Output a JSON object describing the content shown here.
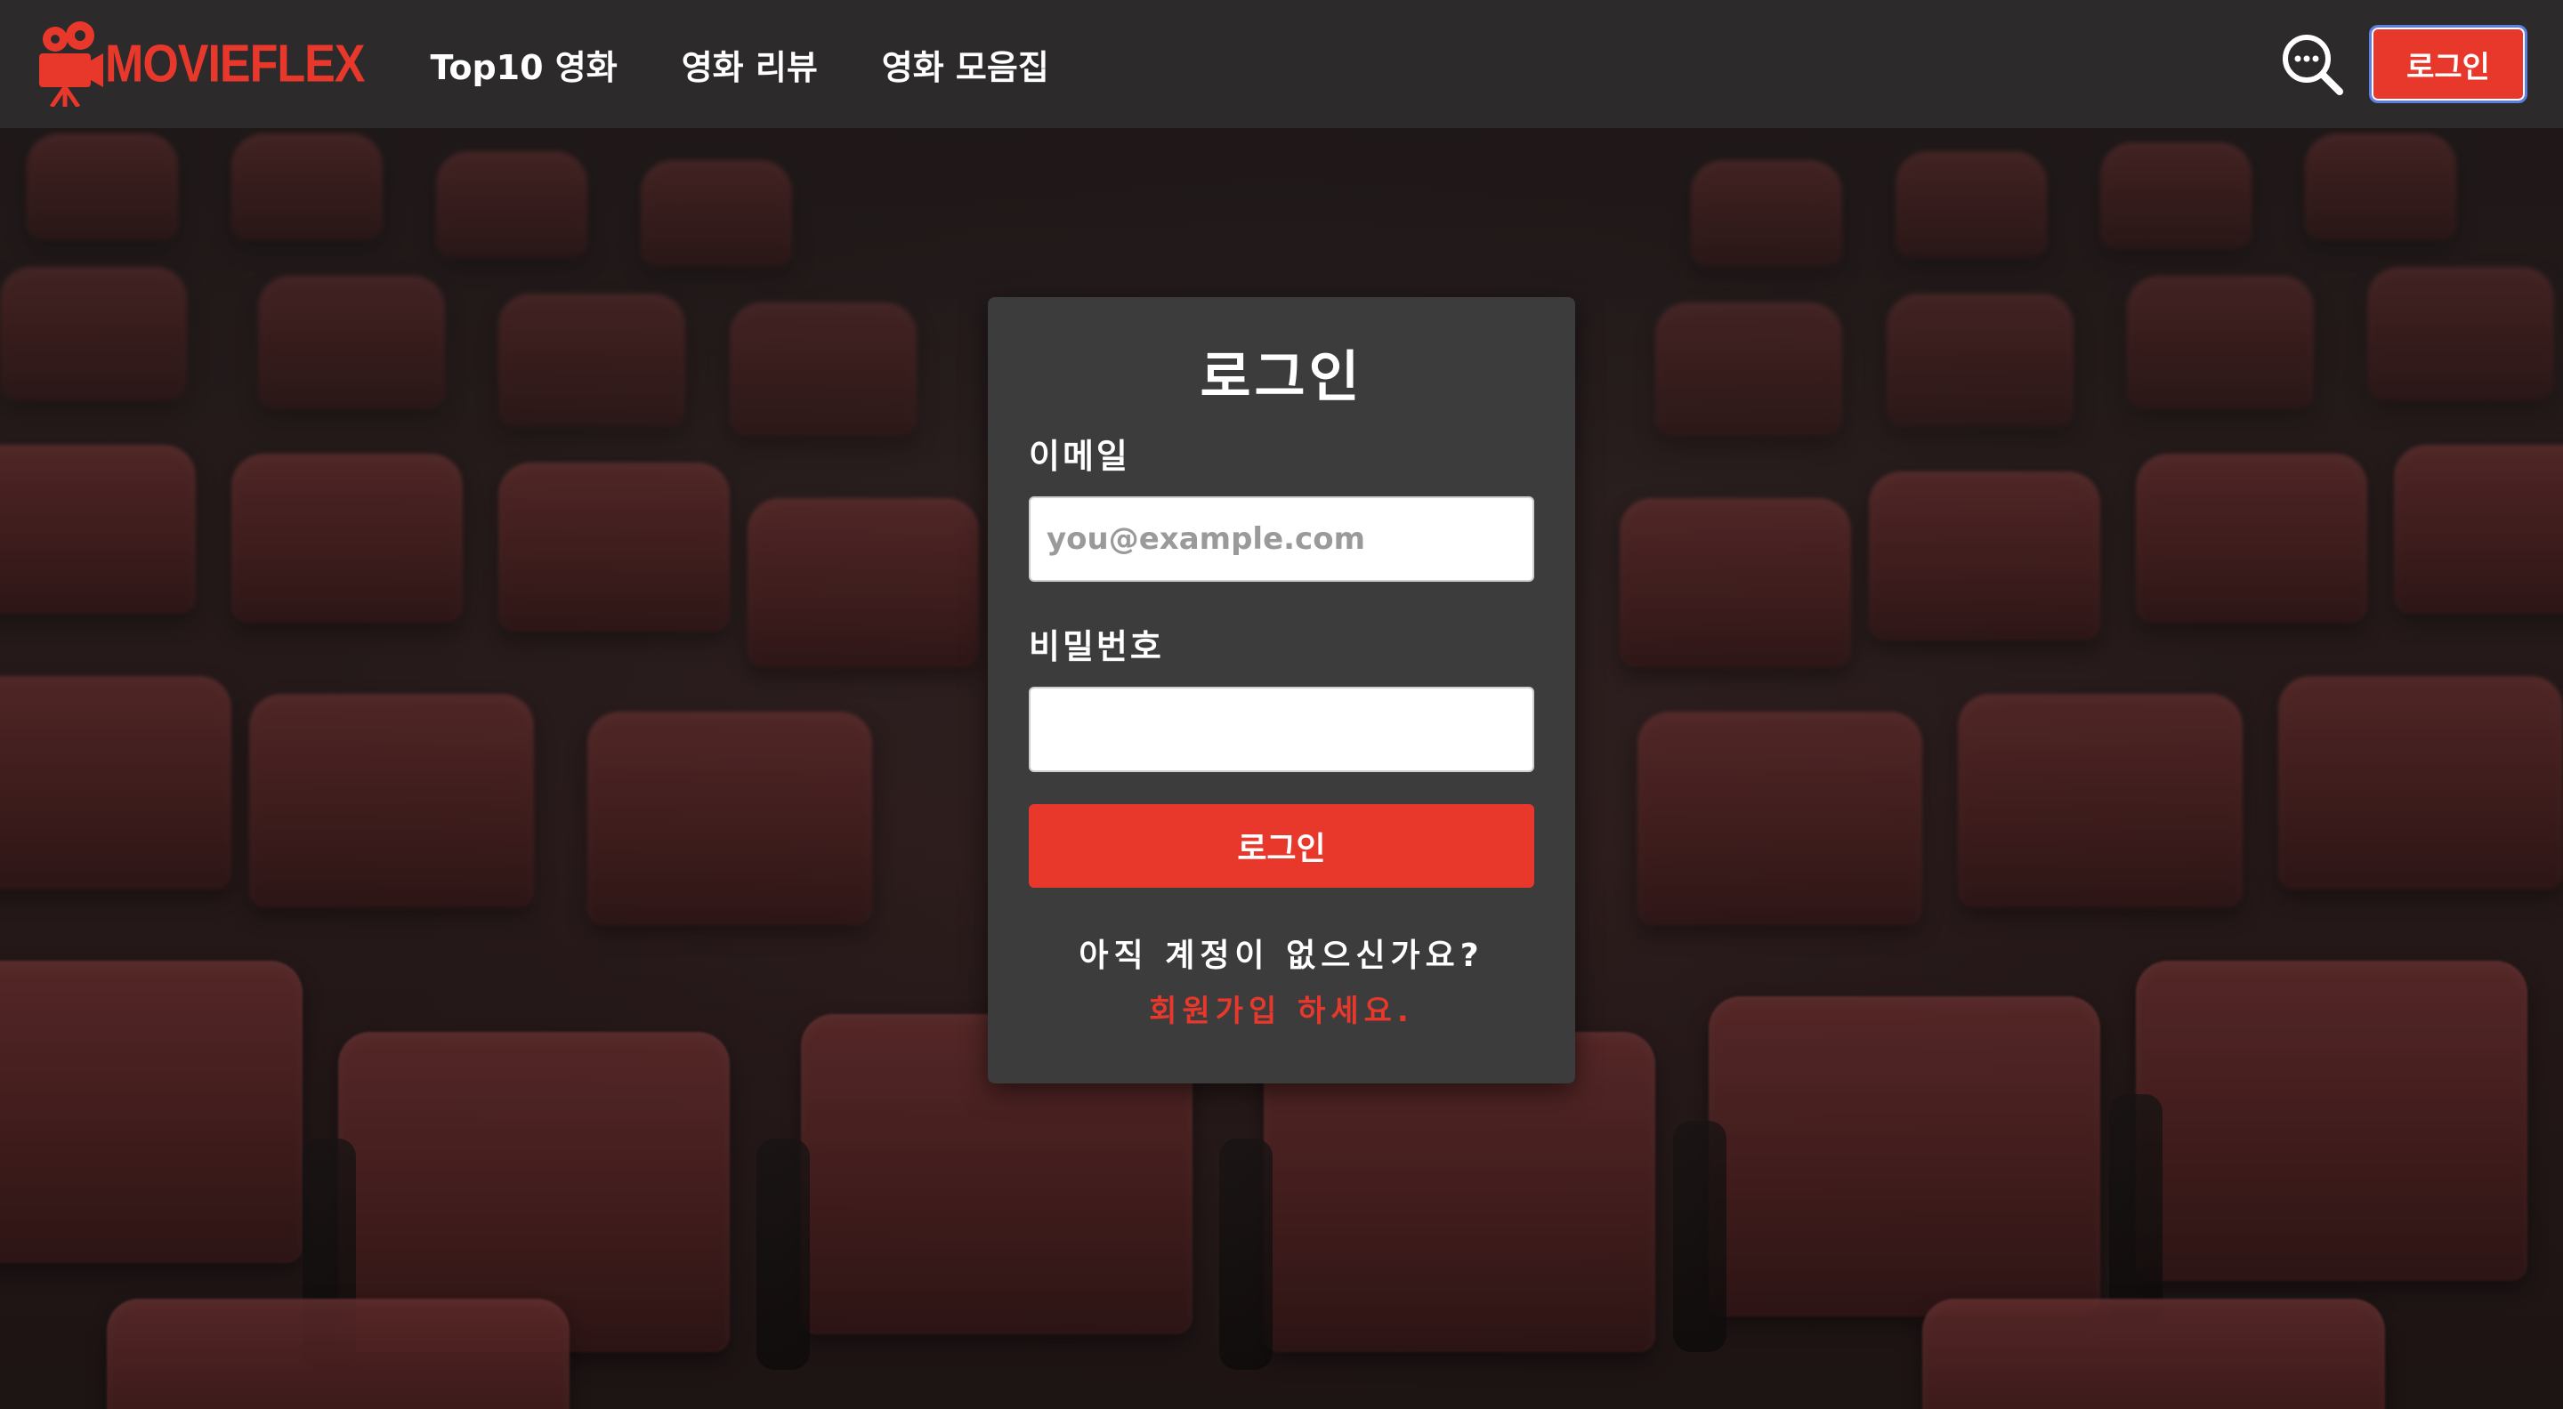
{
  "brand": {
    "name": "MOVIEFLEX",
    "logo_icon": "movie-camera-icon",
    "accent_color": "#e8382c"
  },
  "nav": {
    "items": [
      {
        "label": "Top10 영화"
      },
      {
        "label": "영화 리뷰"
      },
      {
        "label": "영화 모음집"
      }
    ]
  },
  "header": {
    "search_icon": "search-icon",
    "login_label": "로그인"
  },
  "login_form": {
    "title": "로그인",
    "email_label": "이메일",
    "email_placeholder": "you@example.com",
    "email_value": "",
    "password_label": "비밀번호",
    "password_value": "",
    "submit_label": "로그인",
    "signup_prompt": "아직 계정이 없으신가요?",
    "signup_link": "회원가입 하세요."
  },
  "background": {
    "image": "cinema-seats-image",
    "seat_color": "#6a2c2c"
  }
}
